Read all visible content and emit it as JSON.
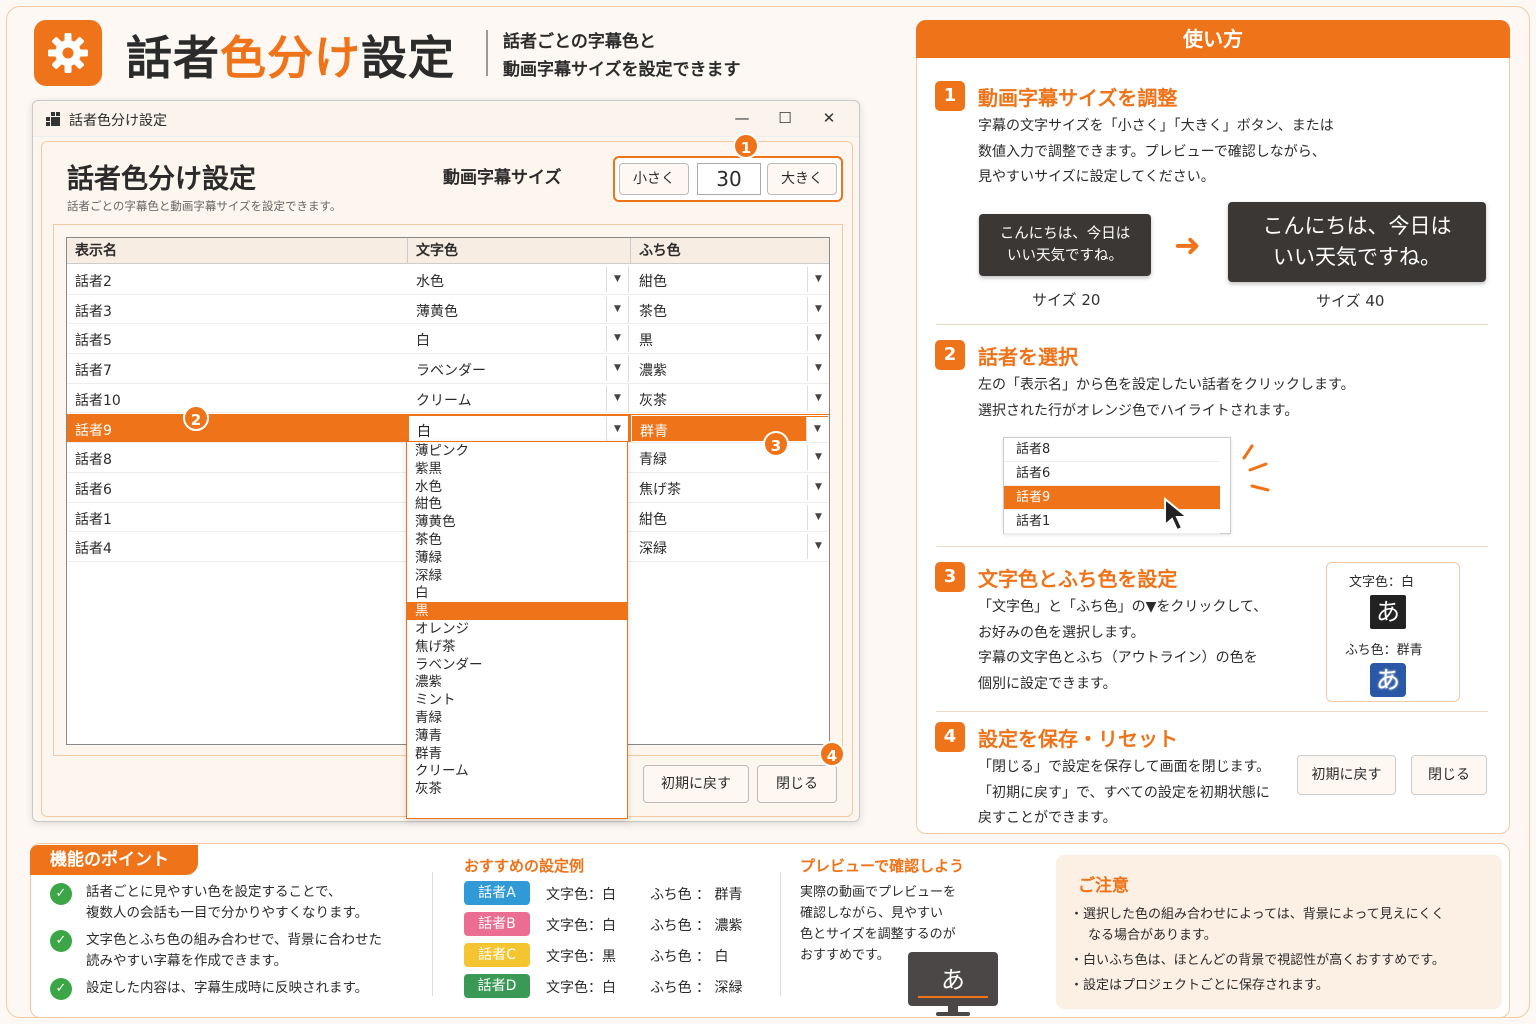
{
  "header": {
    "title_part1": "話者",
    "title_accent": "色分け",
    "title_part2": "設定",
    "subtitle_line1": "話者ごとの字幕色と",
    "subtitle_line2": "動画字幕サイズを設定できます"
  },
  "window": {
    "titlebar": "話者色分け設定",
    "minimize": "—",
    "maximize": "☐",
    "close": "✕",
    "title": "話者色分け設定",
    "description": "話者ごとの字幕色と動画字幕サイズを設定できます。",
    "size_label": "動画字幕サイズ",
    "smaller": "小さく",
    "size_value": "30",
    "larger": "大きく",
    "columns": [
      "表示名",
      "文字色",
      "ふち色"
    ],
    "rows": [
      {
        "name": "話者2",
        "text_color": "水色",
        "edge_color": "紺色"
      },
      {
        "name": "話者3",
        "text_color": "薄黄色",
        "edge_color": "茶色"
      },
      {
        "name": "話者5",
        "text_color": "白",
        "edge_color": "黒"
      },
      {
        "name": "話者7",
        "text_color": "ラベンダー",
        "edge_color": "濃紫"
      },
      {
        "name": "話者10",
        "text_color": "クリーム",
        "edge_color": "灰茶"
      },
      {
        "name": "話者9",
        "text_color": "白",
        "edge_color": "群青"
      },
      {
        "name": "話者8",
        "text_color": "",
        "edge_color": "青緑"
      },
      {
        "name": "話者6",
        "text_color": "",
        "edge_color": "焦げ茶"
      },
      {
        "name": "話者1",
        "text_color": "",
        "edge_color": "紺色"
      },
      {
        "name": "話者4",
        "text_color": "",
        "edge_color": "深緑"
      }
    ],
    "dropdown_options": [
      "薄ピンク",
      "紫黒",
      "水色",
      "紺色",
      "薄黄色",
      "茶色",
      "薄緑",
      "深緑",
      "白",
      "黒",
      "オレンジ",
      "焦げ茶",
      "ラベンダー",
      "濃紫",
      "ミント",
      "青緑",
      "薄青",
      "群青",
      "クリーム",
      "灰茶"
    ],
    "dropdown_highlight": "黒",
    "reset": "初期に戻す",
    "close_btn": "閉じる",
    "badges": [
      "1",
      "2",
      "3",
      "4"
    ]
  },
  "howto": {
    "title": "使い方",
    "step1": {
      "num": "1",
      "title": "動画字幕サイズを調整",
      "desc": [
        "字幕の文字サイズを「小さく」「大きく」ボタン、または",
        "数値入力で調整できます。プレビューで確認しながら、",
        "見やすいサイズに設定してください。"
      ],
      "preview_small": [
        "こんにちは、今日は",
        "いい天気ですね。"
      ],
      "preview_large": [
        "こんにちは、今日は",
        "いい天気ですね。"
      ],
      "arrow": "➜",
      "cap_small": "サイズ 20",
      "cap_large": "サイズ 40"
    },
    "step2": {
      "num": "2",
      "title": "話者を選択",
      "desc": [
        "左の「表示名」から色を設定したい話者をクリックします。",
        "選択された行がオレンジ色でハイライトされます。"
      ],
      "mini_rows": [
        "話者8",
        "話者6",
        "話者9",
        "話者1"
      ],
      "mini_selected": "話者9"
    },
    "step3": {
      "num": "3",
      "title": "文字色とふち色を設定",
      "desc": [
        "「文字色」と「ふち色」の▼をクリックして、",
        "お好みの色を選択します。",
        "字幕の文字色とふち（アウトライン）の色を",
        "個別に設定できます。"
      ],
      "sample_text_label": "文字色：白",
      "sample_edge_label": "ふち色：群青",
      "sample_char": "あ"
    },
    "step4": {
      "num": "4",
      "title": "設定を保存・リセット",
      "desc": [
        "「閉じる」で設定を保存して画面を閉じます。",
        "「初期に戻す」で、すべての設定を初期状態に",
        "戻すことができます。"
      ],
      "reset": "初期に戻す",
      "close": "閉じる"
    }
  },
  "points": {
    "title": "機能のポイント",
    "items": [
      [
        "話者ごとに見やすい色を設定することで、",
        "複数人の会話も一目で分かりやすくなります。"
      ],
      [
        "文字色とふち色の組み合わせで、背景に合わせた",
        "読みやすい字幕を作成できます。"
      ],
      [
        "設定した内容は、字幕生成時に反映されます。"
      ]
    ],
    "check": "✓"
  },
  "examples": {
    "title": "おすすめの設定例",
    "rows": [
      {
        "tag": "話者A",
        "color": "#2f9ad6",
        "text": "文字色：白",
        "edge": "ふち色 ： 群青"
      },
      {
        "tag": "話者B",
        "color": "#ec6d92",
        "text": "文字色：白",
        "edge": "ふち色 ： 濃紫"
      },
      {
        "tag": "話者C",
        "color": "#f4c431",
        "text": "文字色：黒",
        "edge": "ふち色 ： 白"
      },
      {
        "tag": "話者D",
        "color": "#3a9a55",
        "text": "文字色：白",
        "edge": "ふち色 ： 深緑"
      }
    ]
  },
  "preview_tip": {
    "title": "プレビューで確認しよう",
    "lines": [
      "実際の動画でプレビューを",
      "確認しながら、見やすい",
      "色とサイズを調整するのが",
      "おすすめです。"
    ],
    "monitor_char": "あ"
  },
  "caution": {
    "title": "ご注意",
    "items": [
      [
        "選択した色の組み合わせによっては、背景によって見えにくく",
        "なる場合があります。"
      ],
      [
        "白いふち色は、ほとんどの背景で視認性が高くおすすめです。"
      ],
      [
        "設定はプロジェクトごとに保存されます。"
      ]
    ],
    "bullet": "・"
  },
  "colors": {
    "accent": "#ee7319",
    "check": "#3aa646",
    "preview_bg": "#3a3735"
  },
  "icons": [
    "gear-icon",
    "app-icon",
    "arrow-right-icon",
    "cursor-icon",
    "check-icon",
    "monitor-icon",
    "caret-down-icon"
  ]
}
